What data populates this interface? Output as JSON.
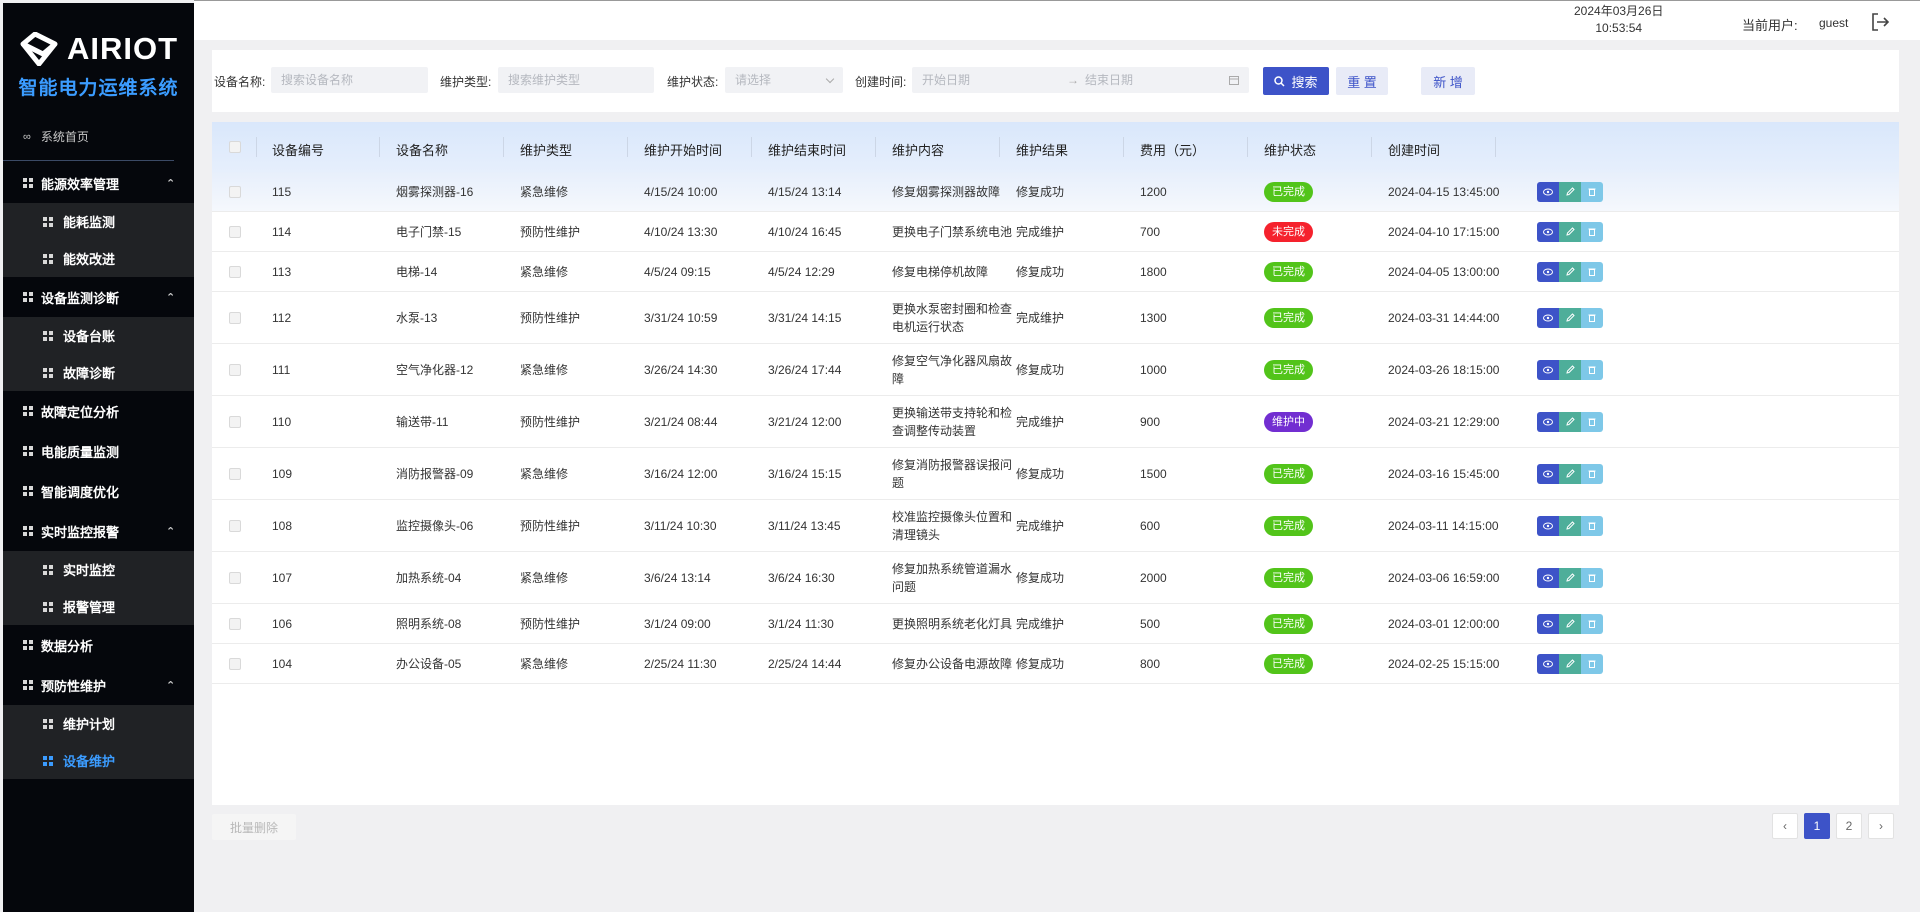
{
  "brand": {
    "name": "AIRIOT",
    "subtitle": "智能电力运维系统"
  },
  "sidebar": {
    "home": "系统首页",
    "groups": [
      {
        "label": "能源效率管理",
        "expanded": true,
        "items": [
          {
            "label": "能耗监测"
          },
          {
            "label": "能效改进"
          }
        ]
      },
      {
        "label": "设备监测诊断",
        "expanded": true,
        "items": [
          {
            "label": "设备台账"
          },
          {
            "label": "故障诊断"
          }
        ]
      },
      {
        "label": "故障定位分析",
        "expanded": false,
        "items": []
      },
      {
        "label": "电能质量监测",
        "expanded": false,
        "items": []
      },
      {
        "label": "智能调度优化",
        "expanded": false,
        "items": []
      },
      {
        "label": "实时监控报警",
        "expanded": true,
        "items": [
          {
            "label": "实时监控"
          },
          {
            "label": "报警管理"
          }
        ]
      },
      {
        "label": "数据分析",
        "expanded": false,
        "items": []
      },
      {
        "label": "预防性维护",
        "expanded": true,
        "items": [
          {
            "label": "维护计划"
          },
          {
            "label": "设备维护",
            "active": true
          }
        ]
      }
    ]
  },
  "header": {
    "date": "2024年03月26日",
    "time": "10:53:54",
    "user_label": "当前用户:",
    "user_name": "guest"
  },
  "filters": {
    "device_name_label": "设备名称:",
    "device_name_placeholder": "搜索设备名称",
    "maint_type_label": "维护类型:",
    "maint_type_placeholder": "搜索维护类型",
    "maint_status_label": "维护状态:",
    "maint_status_placeholder": "请选择",
    "created_label": "创建时间:",
    "start_placeholder": "开始日期",
    "end_placeholder": "结束日期",
    "search_btn": "搜索",
    "reset_btn": "重 置",
    "add_btn": "新 增"
  },
  "table": {
    "columns": [
      "设备编号",
      "设备名称",
      "维护类型",
      "维护开始时间",
      "维护结束时间",
      "维护内容",
      "维护结果",
      "费用（元）",
      "维护状态",
      "创建时间"
    ],
    "rows": [
      {
        "id": "115",
        "name": "烟雾探测器-16",
        "type": "紧急维修",
        "start": "4/15/24 10:00",
        "end": "4/15/24 13:14",
        "content": [
          "修复烟雾探测器故障"
        ],
        "result": "修复成功",
        "cost": "1200",
        "status": "已完成",
        "created": "2024-04-15 13:45:00"
      },
      {
        "id": "114",
        "name": "电子门禁-15",
        "type": "预防性维护",
        "start": "4/10/24 13:30",
        "end": "4/10/24 16:45",
        "content": [
          "更换电子门禁系统电池"
        ],
        "result": "完成维护",
        "cost": "700",
        "status": "未完成",
        "created": "2024-04-10 17:15:00"
      },
      {
        "id": "113",
        "name": "电梯-14",
        "type": "紧急维修",
        "start": "4/5/24 09:15",
        "end": "4/5/24 12:29",
        "content": [
          "修复电梯停机故障"
        ],
        "result": "修复成功",
        "cost": "1800",
        "status": "已完成",
        "created": "2024-04-05 13:00:00"
      },
      {
        "id": "112",
        "name": "水泵-13",
        "type": "预防性维护",
        "start": "3/31/24 10:59",
        "end": "3/31/24 14:15",
        "content": [
          "更换水泵密封圈和检查",
          "电机运行状态"
        ],
        "result": "完成维护",
        "cost": "1300",
        "status": "已完成",
        "created": "2024-03-31 14:44:00"
      },
      {
        "id": "111",
        "name": "空气净化器-12",
        "type": "紧急维修",
        "start": "3/26/24 14:30",
        "end": "3/26/24 17:44",
        "content": [
          "修复空气净化器风扇故",
          "障"
        ],
        "result": "修复成功",
        "cost": "1000",
        "status": "已完成",
        "created": "2024-03-26 18:15:00"
      },
      {
        "id": "110",
        "name": "输送带-11",
        "type": "预防性维护",
        "start": "3/21/24 08:44",
        "end": "3/21/24 12:00",
        "content": [
          "更换输送带支持轮和检",
          "查调整传动装置"
        ],
        "result": "完成维护",
        "cost": "900",
        "status": "维护中",
        "created": "2024-03-21 12:29:00"
      },
      {
        "id": "109",
        "name": "消防报警器-09",
        "type": "紧急维修",
        "start": "3/16/24 12:00",
        "end": "3/16/24 15:15",
        "content": [
          "修复消防报警器误报问",
          "题"
        ],
        "result": "修复成功",
        "cost": "1500",
        "status": "已完成",
        "created": "2024-03-16 15:45:00"
      },
      {
        "id": "108",
        "name": "监控摄像头-06",
        "type": "预防性维护",
        "start": "3/11/24 10:30",
        "end": "3/11/24 13:45",
        "content": [
          "校准监控摄像头位置和",
          "清理镜头"
        ],
        "result": "完成维护",
        "cost": "600",
        "status": "已完成",
        "created": "2024-03-11 14:15:00"
      },
      {
        "id": "107",
        "name": "加热系统-04",
        "type": "紧急维修",
        "start": "3/6/24 13:14",
        "end": "3/6/24 16:30",
        "content": [
          "修复加热系统管道漏水",
          "问题"
        ],
        "result": "修复成功",
        "cost": "2000",
        "status": "已完成",
        "created": "2024-03-06 16:59:00"
      },
      {
        "id": "106",
        "name": "照明系统-08",
        "type": "预防性维护",
        "start": "3/1/24 09:00",
        "end": "3/1/24 11:30",
        "content": [
          "更换照明系统老化灯具"
        ],
        "result": "完成维护",
        "cost": "500",
        "status": "已完成",
        "created": "2024-03-01 12:00:00"
      },
      {
        "id": "104",
        "name": "办公设备-05",
        "type": "紧急维修",
        "start": "2/25/24 11:30",
        "end": "2/25/24 14:44",
        "content": [
          "修复办公设备电源故障"
        ],
        "result": "修复成功",
        "cost": "800",
        "status": "已完成",
        "created": "2024-02-25 15:15:00"
      }
    ]
  },
  "status_colors": {
    "已完成": "#52c41a",
    "未完成": "#f5222d",
    "维护中": "#722ed1"
  },
  "footer": {
    "batch_delete": "批量删除",
    "pages": [
      "1",
      "2"
    ],
    "current_page": "1"
  }
}
